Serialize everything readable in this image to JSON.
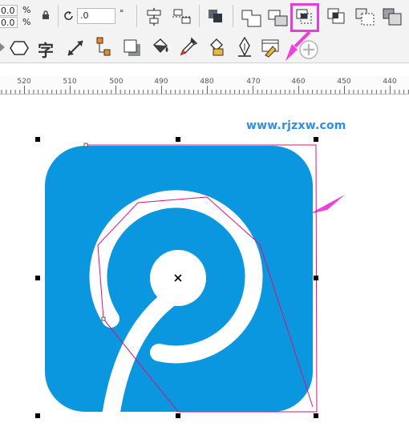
{
  "toolbar": {
    "pos_x_value": "0.0",
    "pos_y_value": "0.0",
    "percent_symbol": "%",
    "rotation_value": ".0",
    "degree_symbol": "°"
  },
  "ruler": {
    "ticks": [
      "520",
      "510",
      "500",
      "490",
      "480",
      "470",
      "460",
      "450",
      "440"
    ]
  },
  "canvas": {
    "watermark": "www.rjzxw.com",
    "logo_color": "#0b97df",
    "selection_outline_color": "#e0107a",
    "arrow_color": "#f23de0"
  },
  "icons": {
    "row1": [
      "lock-icon",
      "rotate-icon",
      "align-icon",
      "distribute-icon",
      "arrange-icon",
      "weld-icon",
      "trim-icon",
      "intersect-icon",
      "simplify-icon",
      "front-minus-back-icon",
      "back-minus-front-icon"
    ],
    "row2": [
      "polygon-icon",
      "text-tool-icon",
      "dimension-icon",
      "connector-icon",
      "drop-shadow-icon",
      "fill-icon",
      "eyedropper-icon",
      "interactive-fill-icon",
      "pen-icon",
      "envelope-icon",
      "add-icon"
    ]
  },
  "highlight": {
    "color": "#e43ddc",
    "target": "back-minus-front-icon"
  }
}
